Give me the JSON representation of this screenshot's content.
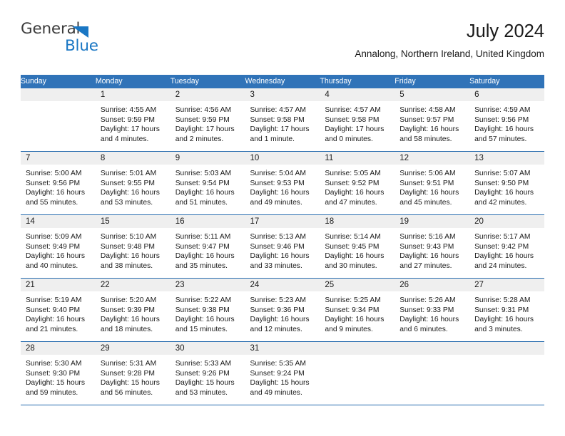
{
  "logo": {
    "text_top": "General",
    "text_bottom": "Blue",
    "triangle_color": "#1a77c4",
    "top_color": "#3c3c3c",
    "bottom_color": "#1a77c4"
  },
  "header": {
    "title": "July 2024",
    "subtitle": "Annalong, Northern Ireland, United Kingdom"
  },
  "theme": {
    "header_blue": "#3073b8",
    "rule_blue": "#2369ad",
    "daynum_band": "#efefef"
  },
  "calendar": {
    "weekday_headers": [
      "Sunday",
      "Monday",
      "Tuesday",
      "Wednesday",
      "Thursday",
      "Friday",
      "Saturday"
    ],
    "weeks": [
      [
        {
          "day": "",
          "lines": []
        },
        {
          "day": "1",
          "lines": [
            "Sunrise: 4:55 AM",
            "Sunset: 9:59 PM",
            "Daylight: 17 hours",
            "and 4 minutes."
          ]
        },
        {
          "day": "2",
          "lines": [
            "Sunrise: 4:56 AM",
            "Sunset: 9:59 PM",
            "Daylight: 17 hours",
            "and 2 minutes."
          ]
        },
        {
          "day": "3",
          "lines": [
            "Sunrise: 4:57 AM",
            "Sunset: 9:58 PM",
            "Daylight: 17 hours",
            "and 1 minute."
          ]
        },
        {
          "day": "4",
          "lines": [
            "Sunrise: 4:57 AM",
            "Sunset: 9:58 PM",
            "Daylight: 17 hours",
            "and 0 minutes."
          ]
        },
        {
          "day": "5",
          "lines": [
            "Sunrise: 4:58 AM",
            "Sunset: 9:57 PM",
            "Daylight: 16 hours",
            "and 58 minutes."
          ]
        },
        {
          "day": "6",
          "lines": [
            "Sunrise: 4:59 AM",
            "Sunset: 9:56 PM",
            "Daylight: 16 hours",
            "and 57 minutes."
          ]
        }
      ],
      [
        {
          "day": "7",
          "lines": [
            "Sunrise: 5:00 AM",
            "Sunset: 9:56 PM",
            "Daylight: 16 hours",
            "and 55 minutes."
          ]
        },
        {
          "day": "8",
          "lines": [
            "Sunrise: 5:01 AM",
            "Sunset: 9:55 PM",
            "Daylight: 16 hours",
            "and 53 minutes."
          ]
        },
        {
          "day": "9",
          "lines": [
            "Sunrise: 5:03 AM",
            "Sunset: 9:54 PM",
            "Daylight: 16 hours",
            "and 51 minutes."
          ]
        },
        {
          "day": "10",
          "lines": [
            "Sunrise: 5:04 AM",
            "Sunset: 9:53 PM",
            "Daylight: 16 hours",
            "and 49 minutes."
          ]
        },
        {
          "day": "11",
          "lines": [
            "Sunrise: 5:05 AM",
            "Sunset: 9:52 PM",
            "Daylight: 16 hours",
            "and 47 minutes."
          ]
        },
        {
          "day": "12",
          "lines": [
            "Sunrise: 5:06 AM",
            "Sunset: 9:51 PM",
            "Daylight: 16 hours",
            "and 45 minutes."
          ]
        },
        {
          "day": "13",
          "lines": [
            "Sunrise: 5:07 AM",
            "Sunset: 9:50 PM",
            "Daylight: 16 hours",
            "and 42 minutes."
          ]
        }
      ],
      [
        {
          "day": "14",
          "lines": [
            "Sunrise: 5:09 AM",
            "Sunset: 9:49 PM",
            "Daylight: 16 hours",
            "and 40 minutes."
          ]
        },
        {
          "day": "15",
          "lines": [
            "Sunrise: 5:10 AM",
            "Sunset: 9:48 PM",
            "Daylight: 16 hours",
            "and 38 minutes."
          ]
        },
        {
          "day": "16",
          "lines": [
            "Sunrise: 5:11 AM",
            "Sunset: 9:47 PM",
            "Daylight: 16 hours",
            "and 35 minutes."
          ]
        },
        {
          "day": "17",
          "lines": [
            "Sunrise: 5:13 AM",
            "Sunset: 9:46 PM",
            "Daylight: 16 hours",
            "and 33 minutes."
          ]
        },
        {
          "day": "18",
          "lines": [
            "Sunrise: 5:14 AM",
            "Sunset: 9:45 PM",
            "Daylight: 16 hours",
            "and 30 minutes."
          ]
        },
        {
          "day": "19",
          "lines": [
            "Sunrise: 5:16 AM",
            "Sunset: 9:43 PM",
            "Daylight: 16 hours",
            "and 27 minutes."
          ]
        },
        {
          "day": "20",
          "lines": [
            "Sunrise: 5:17 AM",
            "Sunset: 9:42 PM",
            "Daylight: 16 hours",
            "and 24 minutes."
          ]
        }
      ],
      [
        {
          "day": "21",
          "lines": [
            "Sunrise: 5:19 AM",
            "Sunset: 9:40 PM",
            "Daylight: 16 hours",
            "and 21 minutes."
          ]
        },
        {
          "day": "22",
          "lines": [
            "Sunrise: 5:20 AM",
            "Sunset: 9:39 PM",
            "Daylight: 16 hours",
            "and 18 minutes."
          ]
        },
        {
          "day": "23",
          "lines": [
            "Sunrise: 5:22 AM",
            "Sunset: 9:38 PM",
            "Daylight: 16 hours",
            "and 15 minutes."
          ]
        },
        {
          "day": "24",
          "lines": [
            "Sunrise: 5:23 AM",
            "Sunset: 9:36 PM",
            "Daylight: 16 hours",
            "and 12 minutes."
          ]
        },
        {
          "day": "25",
          "lines": [
            "Sunrise: 5:25 AM",
            "Sunset: 9:34 PM",
            "Daylight: 16 hours",
            "and 9 minutes."
          ]
        },
        {
          "day": "26",
          "lines": [
            "Sunrise: 5:26 AM",
            "Sunset: 9:33 PM",
            "Daylight: 16 hours",
            "and 6 minutes."
          ]
        },
        {
          "day": "27",
          "lines": [
            "Sunrise: 5:28 AM",
            "Sunset: 9:31 PM",
            "Daylight: 16 hours",
            "and 3 minutes."
          ]
        }
      ],
      [
        {
          "day": "28",
          "lines": [
            "Sunrise: 5:30 AM",
            "Sunset: 9:30 PM",
            "Daylight: 15 hours",
            "and 59 minutes."
          ]
        },
        {
          "day": "29",
          "lines": [
            "Sunrise: 5:31 AM",
            "Sunset: 9:28 PM",
            "Daylight: 15 hours",
            "and 56 minutes."
          ]
        },
        {
          "day": "30",
          "lines": [
            "Sunrise: 5:33 AM",
            "Sunset: 9:26 PM",
            "Daylight: 15 hours",
            "and 53 minutes."
          ]
        },
        {
          "day": "31",
          "lines": [
            "Sunrise: 5:35 AM",
            "Sunset: 9:24 PM",
            "Daylight: 15 hours",
            "and 49 minutes."
          ]
        },
        {
          "day": "",
          "lines": []
        },
        {
          "day": "",
          "lines": []
        },
        {
          "day": "",
          "lines": []
        }
      ]
    ]
  }
}
